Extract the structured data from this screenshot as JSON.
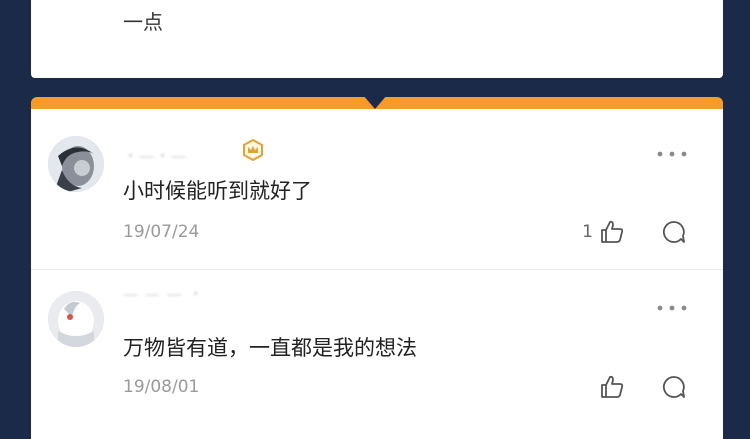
{
  "previous_comment": {
    "text_tail": "一点"
  },
  "comments": [
    {
      "username": "・—・—",
      "text": "小时候能听到就好了",
      "date": "19/07/24",
      "likes": "1"
    },
    {
      "username": "— — — ・",
      "text": "万物皆有道，一直都是我的想法",
      "date": "19/08/01",
      "likes": ""
    }
  ],
  "icons": {
    "badge": "crown-badge-icon",
    "more": "more-dots-icon",
    "like": "thumbs-up-icon",
    "reply": "comment-bubble-icon"
  },
  "colors": {
    "background": "#1c2a4a",
    "accent": "#f39b2b",
    "badge": "#e0a23b"
  }
}
